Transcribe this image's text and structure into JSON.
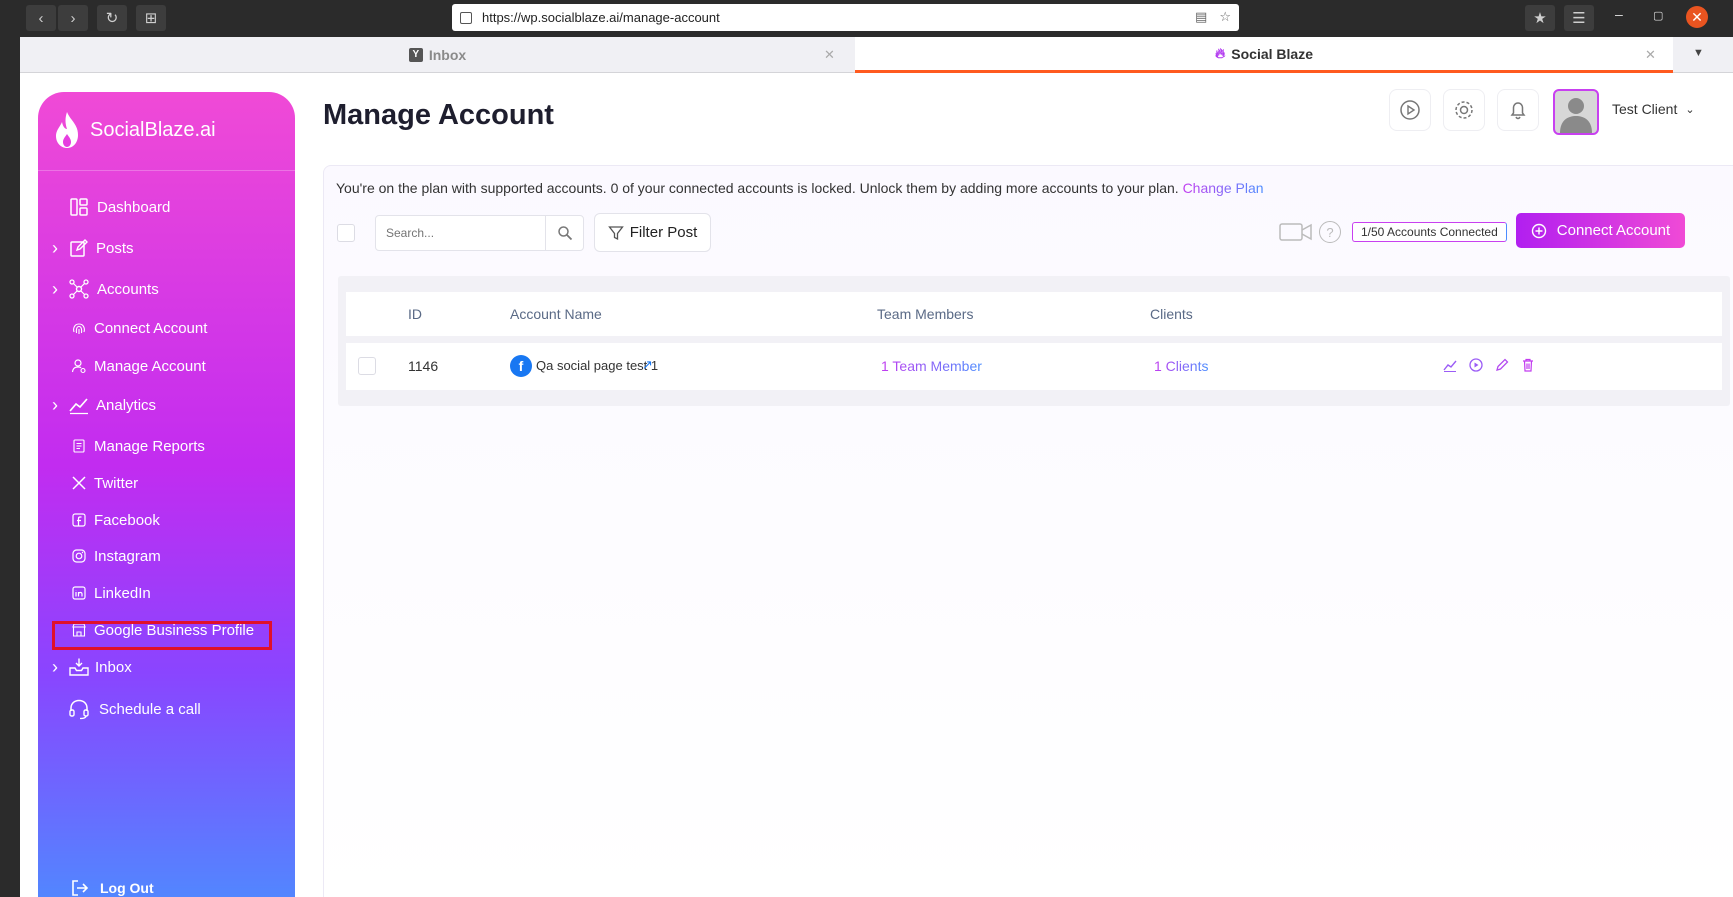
{
  "browser": {
    "url": "https://wp.socialblaze.ai/manage-account",
    "tabs": [
      {
        "label": "Inbox",
        "active": false
      },
      {
        "label": "Social Blaze",
        "active": true
      }
    ]
  },
  "brand": {
    "name": "SocialBlaze.ai",
    "accent": "#c22cf0",
    "accent_blue": "#4c8dff",
    "highlight_box": "#e0102a"
  },
  "sidebar": {
    "items": [
      {
        "label": "Dashboard",
        "icon": "dashboard-icon",
        "expandable": false
      },
      {
        "label": "Posts",
        "icon": "edit-icon",
        "expandable": true
      },
      {
        "label": "Accounts",
        "icon": "network-icon",
        "expandable": true
      },
      {
        "label": "Connect Account",
        "icon": "fingerprint-icon",
        "expandable": false
      },
      {
        "label": "Manage Account",
        "icon": "user-cog-icon",
        "expandable": false
      },
      {
        "label": "Analytics",
        "icon": "chart-icon",
        "expandable": true
      },
      {
        "label": "Manage Reports",
        "icon": "report-icon",
        "expandable": false
      },
      {
        "label": "Twitter",
        "icon": "x-icon",
        "expandable": false
      },
      {
        "label": "Facebook",
        "icon": "facebook-icon",
        "expandable": false
      },
      {
        "label": "Instagram",
        "icon": "instagram-icon",
        "expandable": false
      },
      {
        "label": "LinkedIn",
        "icon": "linkedin-icon",
        "expandable": false
      },
      {
        "label": "Google Business Profile",
        "icon": "store-icon",
        "expandable": false
      },
      {
        "label": "Inbox",
        "icon": "inbox-icon",
        "expandable": true
      },
      {
        "label": "Schedule a call",
        "icon": "headset-icon",
        "expandable": false
      }
    ],
    "logout": "Log Out"
  },
  "header": {
    "title": "Manage Account",
    "user_name": "Test Client"
  },
  "main": {
    "notice_text": "You're on the plan with supported accounts. 0 of your connected accounts is locked. Unlock them by adding more accounts to your plan.",
    "notice_link": "Change Plan",
    "search_placeholder": "Search...",
    "filter_label": "Filter Post",
    "connected_badge": "1/50 Accounts Connected",
    "connect_button": "Connect Account",
    "table": {
      "columns": [
        "ID",
        "Account Name",
        "Team Members",
        "Clients"
      ],
      "rows": [
        {
          "id": "1146",
          "account_name": "Qa social page test 1",
          "team_members": "1 Team Member",
          "clients": "1 Clients"
        }
      ]
    }
  }
}
